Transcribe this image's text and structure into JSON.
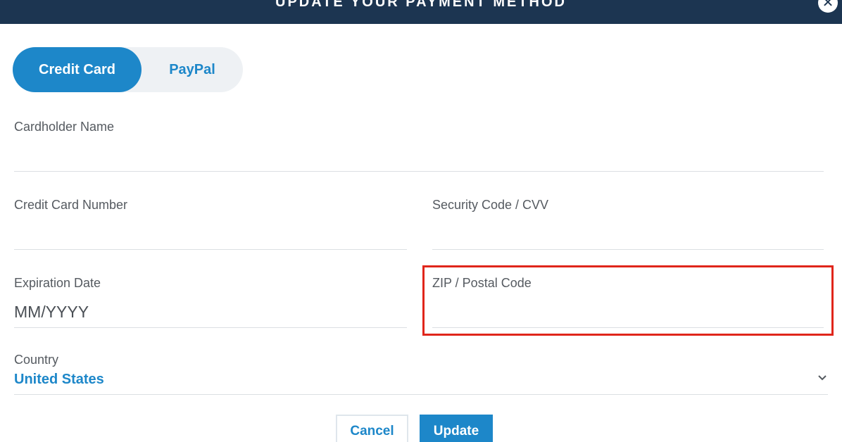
{
  "modal": {
    "title": "UPDATE YOUR PAYMENT METHOD",
    "close_icon": "close-icon"
  },
  "payment_toggle": {
    "options": [
      {
        "label": "Credit Card",
        "active": true
      },
      {
        "label": "PayPal",
        "active": false
      }
    ]
  },
  "form": {
    "cardholder_name": {
      "label": "Cardholder Name",
      "value": "",
      "placeholder": ""
    },
    "card_number": {
      "label": "Credit Card Number",
      "value": "",
      "placeholder": ""
    },
    "security_code": {
      "label": "Security Code / CVV",
      "value": "",
      "placeholder": ""
    },
    "expiration_date": {
      "label": "Expiration Date",
      "value": "",
      "placeholder": "MM/YYYY"
    },
    "zip_code": {
      "label": "ZIP / Postal Code",
      "value": "",
      "placeholder": "",
      "highlighted": true
    },
    "country": {
      "label": "Country",
      "value": "United States",
      "icon": "chevron-down-icon"
    }
  },
  "actions": {
    "cancel_label": "Cancel",
    "update_label": "Update"
  },
  "colors": {
    "header_bg": "#1c3551",
    "accent": "#1d87c9",
    "highlight": "#e0261b",
    "toggle_bg": "#eef1f4"
  }
}
